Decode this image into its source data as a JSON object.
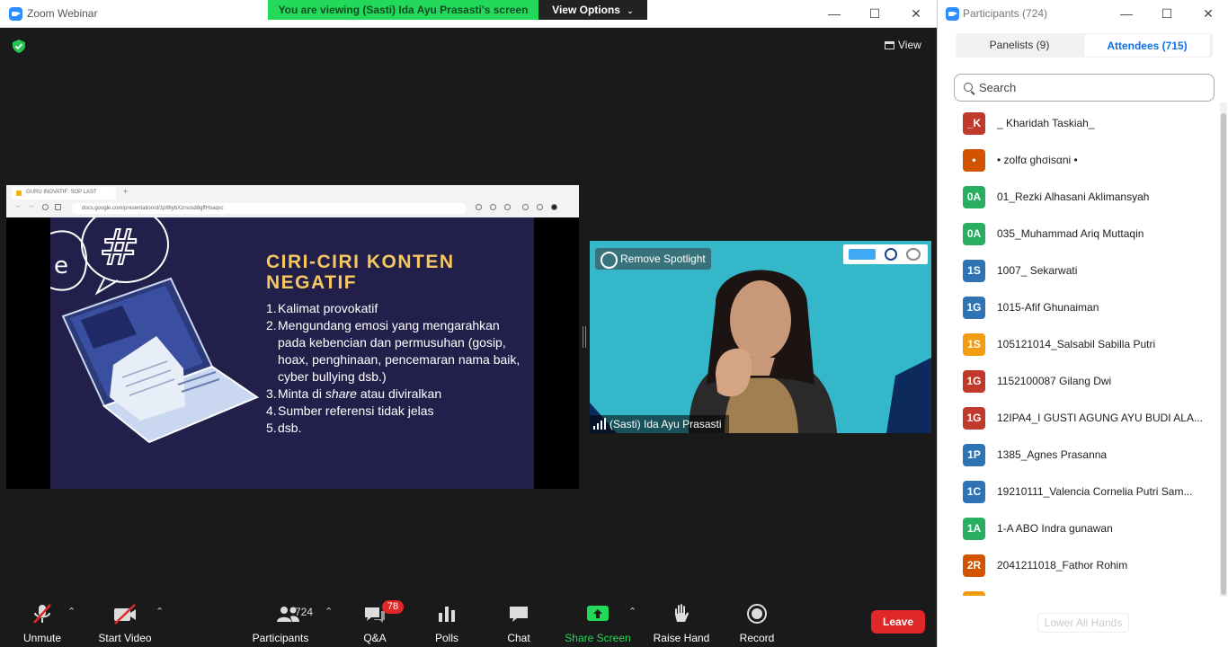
{
  "window": {
    "title": "Zoom Webinar",
    "viewing_banner": "You are viewing (Sasti) Ida Ayu Prasasti's screen",
    "view_options": "View Options",
    "view_label": "View"
  },
  "share": {
    "tab_title": "GURU INOVATIF: SOP LAST",
    "url": "docs.google.com/presentation/d/1pt8lybXzrsosd8gffHsaqsc",
    "slide": {
      "title_line1": "CIRI-CIRI KONTEN",
      "title_line2": "NEGATIF",
      "items": [
        {
          "num": "1.",
          "text": "Kalimat provokatif"
        },
        {
          "num": "2.",
          "text": "Mengundang emosi yang mengarahkan pada kebencian dan permusuhan (gosip, hoax, penghinaan, pencemaran nama baik, cyber bullying dsb.)"
        },
        {
          "num": "3.",
          "text_before": "Minta di ",
          "text_em": "share",
          "text_after": " atau diviralkan"
        },
        {
          "num": "4.",
          "text": "Sumber referensi tidak jelas"
        },
        {
          "num": "5.",
          "text": "dsb."
        }
      ]
    }
  },
  "video": {
    "spotlight_label": "Remove Spotlight",
    "name_label": "(Sasti) Ida Ayu Prasasti"
  },
  "toolbar": {
    "unmute": "Unmute",
    "start_video": "Start Video",
    "participants": "Participants",
    "participants_count": "724",
    "qa": "Q&A",
    "qa_badge": "78",
    "polls": "Polls",
    "chat": "Chat",
    "share_screen": "Share Screen",
    "raise_hand": "Raise Hand",
    "record": "Record",
    "leave": "Leave"
  },
  "panel": {
    "title": "Participants (724)",
    "tab_panelists": "Panelists (9)",
    "tab_attendees": "Attendees (715)",
    "search_placeholder": "Search",
    "lower_hands": "Lower All Hands",
    "participants": [
      {
        "initials": "_K",
        "name": "_ Kharidah Taskiah_",
        "color": "#c0392b"
      },
      {
        "initials": "•",
        "name": "• zolfα ghσisαni •",
        "color": "#d35400"
      },
      {
        "initials": "0A",
        "name": "01_Rezki Alhasani Aklimansyah",
        "color": "#27ae60"
      },
      {
        "initials": "0A",
        "name": "035_Muhammad Ariq Muttaqin",
        "color": "#27ae60"
      },
      {
        "initials": "1S",
        "name": "1007_ Sekarwati",
        "color": "#2e74b5"
      },
      {
        "initials": "1G",
        "name": "1015-Afif Ghunaiman",
        "color": "#2e74b5"
      },
      {
        "initials": "1S",
        "name": "105121014_Salsabil Sabilla Putri",
        "color": "#f39c12"
      },
      {
        "initials": "1G",
        "name": "1152100087 Gilang Dwi",
        "color": "#c0392b"
      },
      {
        "initials": "1G",
        "name": "12IPA4_I GUSTI AGUNG AYU BUDI ALA...",
        "color": "#c0392b"
      },
      {
        "initials": "1P",
        "name": "1385_Agnes Prasanna",
        "color": "#2e74b5"
      },
      {
        "initials": "1C",
        "name": "19210111_Valencia Cornelia Putri Sam...",
        "color": "#2e74b5"
      },
      {
        "initials": "1A",
        "name": "1-A ABO Indra gunawan",
        "color": "#27ae60"
      },
      {
        "initials": "2R",
        "name": "2041211018_Fathor Rohim",
        "color": "#d35400"
      },
      {
        "initials": "",
        "name": "",
        "color": "#f39c12"
      }
    ]
  },
  "colors": {
    "accent": "#0e72ed",
    "banner_green": "#23d959",
    "leave_red": "#e02828",
    "share_green": "#23d959"
  }
}
